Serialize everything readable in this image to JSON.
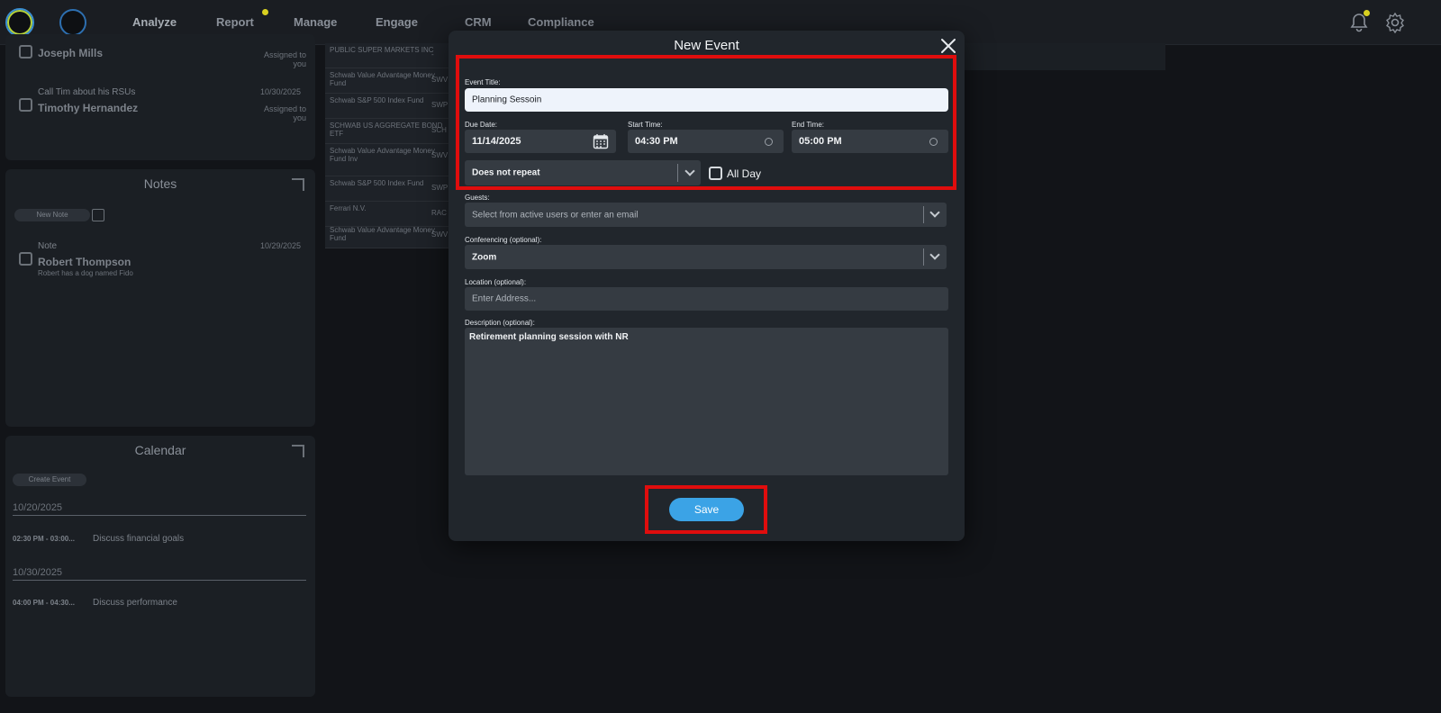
{
  "nav": {
    "items": [
      {
        "label": "Analyze"
      },
      {
        "label": "Report"
      },
      {
        "label": "Manage"
      },
      {
        "label": "Engage"
      },
      {
        "label": "CRM"
      },
      {
        "label": "Compliance"
      }
    ]
  },
  "tasks": {
    "item1": {
      "name": "Joseph Mills",
      "assigned": "Assigned to you"
    },
    "item2": {
      "title": "Call Tim about his RSUs",
      "date": "10/30/2025",
      "name": "Timothy Hernandez",
      "assigned": "Assigned to you"
    }
  },
  "notes": {
    "title": "Notes",
    "new_note": "New Note",
    "item": {
      "label": "Note",
      "date": "10/29/2025",
      "name": "Robert Thompson",
      "desc": "Robert has a dog named Fido"
    }
  },
  "calendar": {
    "title": "Calendar",
    "create_event": "Create Event",
    "groups": [
      {
        "date": "10/20/2025",
        "time": "02:30 PM - 03:00...",
        "desc": "Discuss financial goals"
      },
      {
        "date": "10/30/2025",
        "time": "04:00 PM - 04:30...",
        "desc": "Discuss performance"
      }
    ]
  },
  "holdings": [
    {
      "name": "PUBLIC SUPER MARKETS INC",
      "code": "-"
    },
    {
      "name": "Schwab Value Advantage Money Fund",
      "code": "SWV"
    },
    {
      "name": "Schwab S&P 500 Index Fund",
      "code": "SWP"
    },
    {
      "name": "SCHWAB US AGGREGATE BOND ETF",
      "code": "SCH"
    },
    {
      "name": "Schwab Value Advantage Money Fund Inv",
      "code": "SWV"
    },
    {
      "name": "Schwab S&P 500 Index Fund",
      "code": "SWP"
    },
    {
      "name": "Ferrari N.V.",
      "code": "RAC"
    },
    {
      "name": "Schwab Value Advantage Money Fund",
      "code": "SWV"
    }
  ],
  "modal": {
    "title": "New Event",
    "event_title_label": "Event Title:",
    "event_title_value": "Planning Sessoin",
    "due_date_label": "Due Date:",
    "due_date_value": "11/14/2025",
    "start_time_label": "Start Time:",
    "start_time_value": "04:30 PM",
    "end_time_label": "End Time:",
    "end_time_value": "05:00 PM",
    "repeat_value": "Does not repeat",
    "all_day_label": "All Day",
    "guests_label": "Guests:",
    "guests_placeholder": "Select from active users or enter an email",
    "conferencing_label": "Conferencing (optional):",
    "conferencing_value": "Zoom",
    "location_label": "Location (optional):",
    "location_placeholder": "Enter Address...",
    "description_label": "Description (optional):",
    "description_value": "Retirement planning session with NR",
    "save_label": "Save"
  },
  "colors": {
    "accent": "#3ba3e6",
    "highlight": "#e00d0d",
    "modal_bg": "#21262c"
  }
}
